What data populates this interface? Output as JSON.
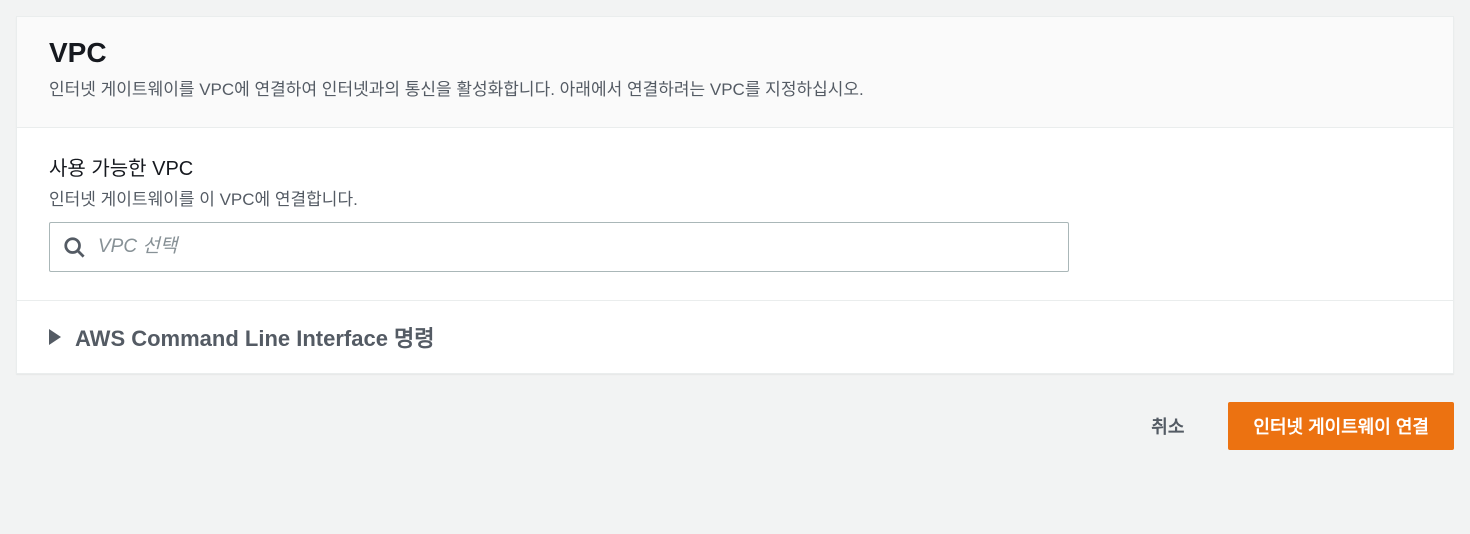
{
  "header": {
    "title": "VPC",
    "description": "인터넷 게이트웨이를 VPC에 연결하여 인터넷과의 통신을 활성화합니다. 아래에서 연결하려는 VPC를 지정하십시오."
  },
  "form": {
    "vpc_field": {
      "label": "사용 가능한 VPC",
      "description": "인터넷 게이트웨이를 이 VPC에 연결합니다.",
      "placeholder": "VPC 선택"
    }
  },
  "expandable": {
    "title": "AWS Command Line Interface 명령"
  },
  "actions": {
    "cancel": "취소",
    "submit": "인터넷 게이트웨이 연결"
  }
}
